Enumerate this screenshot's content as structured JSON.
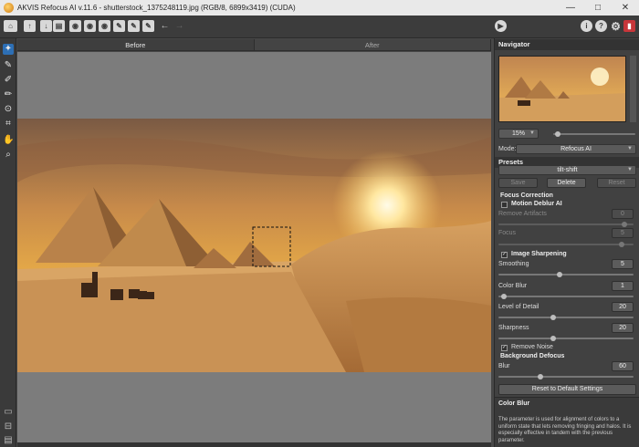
{
  "window": {
    "title": "AKVIS Refocus AI v.11.6 - shutterstock_1375248119.jpg (RGB/8, 6899x3419) (CUDA)",
    "minimize": "—",
    "maximize": "□",
    "close": "✕"
  },
  "toolbar": {
    "icons": [
      "home-icon",
      "open-icon",
      "save-icon",
      "print-icon",
      "import-presets-icon",
      "export-presets-icon",
      "batch-icon",
      "eraser-plugin-icon",
      "brush-icon",
      "undo-icon",
      "redo-icon",
      "run-icon",
      "info-icon",
      "help-icon",
      "settings-icon",
      "tutorial-icon"
    ]
  },
  "tabs": {
    "before": "Before",
    "after": "After"
  },
  "navigator": {
    "title": "Navigator",
    "zoom": "15%"
  },
  "settings": {
    "mode_label": "Mode:",
    "mode_value": "Refocus AI",
    "presets_title": "Presets",
    "preset_value": "tilt-shift",
    "save_label": "Save",
    "delete_label": "Delete",
    "reset_label": "Reset",
    "focus_correction_title": "Focus Correction",
    "motion_deblur_label": "Motion Deblur AI",
    "remove_artifacts_label": "Remove Artifacts",
    "remove_artifacts_value": "0",
    "remove_artifacts_level": 0.95,
    "focus_label": "Focus",
    "focus_value": "5",
    "focus_level": 0.93,
    "image_sharpening_label": "Image Sharpening",
    "smoothing_label": "Smoothing",
    "smoothing_value": "5",
    "smoothing_level": 0.45,
    "color_blur_label": "Color Blur",
    "color_blur_value": "1",
    "color_blur_level": 0.02,
    "level_of_detail_label": "Level of Detail",
    "level_of_detail_value": "20",
    "level_of_detail_level": 0.4,
    "sharpness_label": "Sharpness",
    "sharpness_value": "20",
    "sharpness_level": 0.4,
    "remove_noise_label": "Remove Noise",
    "background_defocus_title": "Background Defocus",
    "blur_label": "Blur",
    "blur_value": "60",
    "blur_level": 0.3,
    "reset_defaults_label": "Reset to Default Settings"
  },
  "hint": {
    "title": "Color Blur",
    "text": "The parameter is used for alignment of colors to a uniform state that lets removing fringing and halos. It is especially effective in tandem with the previous parameter."
  },
  "colors": {
    "accent": "#2d6fb5",
    "panel": "#414141",
    "canvas": "#7c7c7c"
  }
}
